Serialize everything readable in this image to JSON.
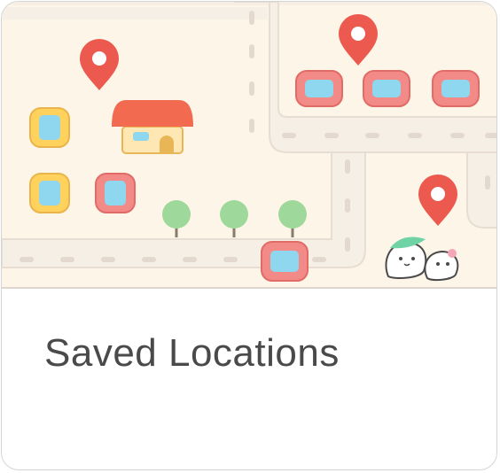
{
  "card": {
    "title": "Saved Locations"
  },
  "colors": {
    "background": "#fdf6e8",
    "road": "#f6efe6",
    "road_edge": "#e7ddd2",
    "pin": "#ec5a4f",
    "car_red": "#f28a88",
    "car_yellow": "#ffd25e",
    "window_blue": "#8fd6ef",
    "roof": "#f26a50",
    "tree": "#9ed89a",
    "title_text": "#4a4a4a"
  },
  "icons": [
    "location-pin-icon",
    "car-icon",
    "house-icon",
    "tree-icon",
    "mascot-icon"
  ]
}
